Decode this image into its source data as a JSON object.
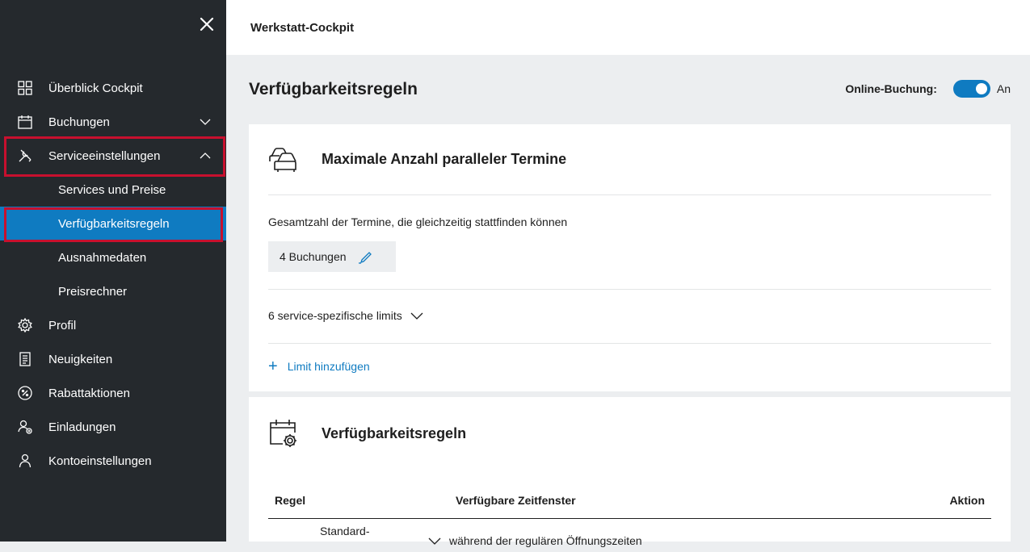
{
  "sidebar": {
    "items": [
      {
        "label": "Überblick Cockpit",
        "icon": "grid-icon"
      },
      {
        "label": "Buchungen",
        "icon": "calendar-icon"
      },
      {
        "label": "Serviceeinstellungen",
        "icon": "tools-icon"
      },
      {
        "label": "Profil",
        "icon": "gear-icon"
      },
      {
        "label": "Neuigkeiten",
        "icon": "document-icon"
      },
      {
        "label": "Rabattaktionen",
        "icon": "percent-icon"
      },
      {
        "label": "Einladungen",
        "icon": "invite-user-icon"
      },
      {
        "label": "Kontoeinstellungen",
        "icon": "user-icon"
      }
    ],
    "subitems": [
      {
        "label": "Services und Preise"
      },
      {
        "label": "Verfügbarkeitsregeln"
      },
      {
        "label": "Ausnahmedaten"
      },
      {
        "label": "Preisrechner"
      }
    ]
  },
  "header": {
    "app_title": "Werkstatt-Cockpit"
  },
  "main": {
    "page_title": "Verfügbarkeitsregeln",
    "online_label": "Online-Buchung:",
    "online_state": "An"
  },
  "card1": {
    "title": "Maximale Anzahl paralleler Termine",
    "description": "Gesamtzahl der Termine, die gleichzeitig stattfinden können",
    "bookings": "4 Buchungen",
    "limits": "6 service-spezifische limits",
    "add_limit": "Limit hinzufügen"
  },
  "card2": {
    "title": "Verfügbarkeitsregeln",
    "columns": [
      "Regel",
      "Verfügbare Zeitfenster",
      "Aktion"
    ],
    "row1": {
      "rule": "Standard-",
      "window": "während der regulären Öffnungszeiten"
    }
  },
  "colors": {
    "accent": "#0f7bc1",
    "sidebar_bg": "#25292d",
    "highlight": "#c8102e"
  }
}
